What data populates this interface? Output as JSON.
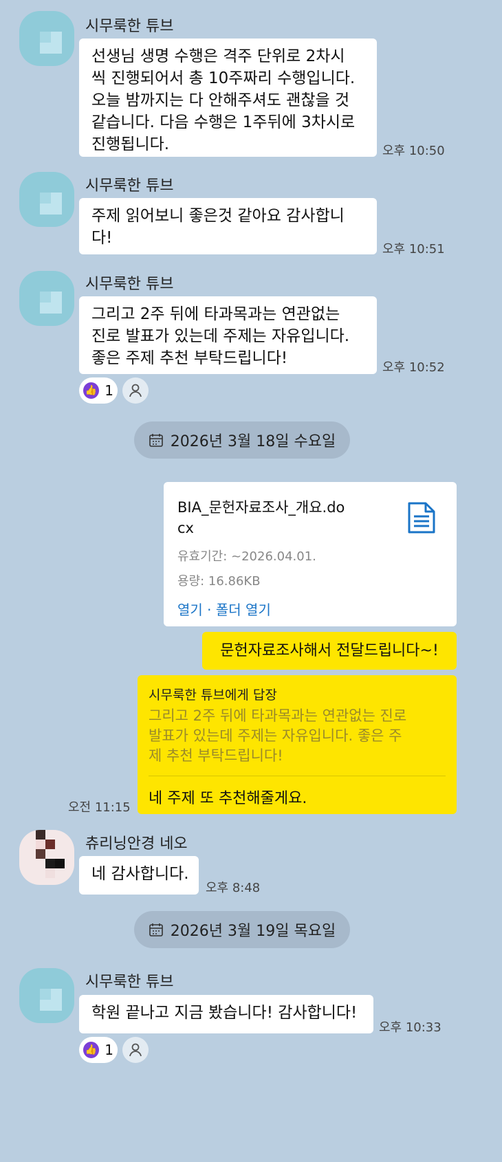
{
  "colors": {
    "background": "#bacee0",
    "my_bubble": "#fee500",
    "reaction": "#7b3fd6",
    "link": "#1a74c7"
  },
  "messages_a": [
    {
      "sender": "시무룩한 튜브",
      "text": "선생님 생명 수행은 격주 단위로 2차시\n씩 진행되어서 총 10주짜리 수행입니다.\n오늘 밤까지는 다 안해주셔도 괜찮을 것\n같습니다. 다음 수행은 1주뒤에 3차시로\n진행됩니다.",
      "time": "오후 10:50"
    },
    {
      "sender": "시무룩한 튜브",
      "text": "주제 읽어보니 좋은것 같아요 감사합니\n다!",
      "time": "오후 10:51"
    },
    {
      "sender": "시무룩한 튜브",
      "text": "그리고 2주 뒤에 타과목과는 연관없는\n진로 발표가 있는데 주제는 자유입니다.\n좋은 주제 추천 부탁드립니다!",
      "time": "오후 10:52",
      "reaction_count": "1"
    }
  ],
  "date1": "2026년 3월 18일 수요일",
  "file": {
    "name": "BIA_문헌자료조사_개요.do\ncx",
    "expiry": "유효기간: ~2026.04.01.",
    "size": "용량: 16.86KB",
    "open": "열기",
    "sep": " · ",
    "open_folder": "폴더 열기",
    "icon": "document-icon"
  },
  "my_msg1": "문헌자료조사해서 전달드립니다~!",
  "reply": {
    "to": "시무룩한 튜브에게 답장",
    "quoted": "그리고 2주 뒤에 타과목과는 연관없는 진로\n발표가 있는데 주제는 자유입니다. 좋은 주\n제 추천 부탁드립니다!",
    "text": "네 주제 또 추천해줄게요.",
    "time": "오전 11:15"
  },
  "msg_neo": {
    "sender": "츄리닝안경 네오",
    "text": "네 감사합니다.",
    "time": "오후 8:48"
  },
  "date2": "2026년 3월 19일 목요일",
  "msg_last": {
    "sender": "시무룩한 튜브",
    "text": "학원 끝나고 지금 봤습니다! 감사합니다!",
    "time": "오후 10:33",
    "reaction_count": "1"
  }
}
